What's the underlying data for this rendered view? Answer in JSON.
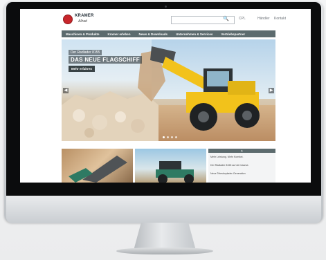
{
  "site": {
    "logo_text": "KRAMER",
    "logo_slogan": "Allrad",
    "header_links": [
      "CPL",
      "Händler",
      "Kontakt"
    ]
  },
  "nav": {
    "items": [
      "Maschinen & Produkte",
      "Kramer erleben",
      "News & Downloads",
      "Unternehmen & Services",
      "Vertriebspartner"
    ]
  },
  "hero": {
    "caption_small": "Der Radlader 8155",
    "caption_large": "DAS NEUE FLAGSCHIFF",
    "button_label": "Mehr erfahren",
    "arrow_left": "◀",
    "arrow_right": "▶",
    "slide_count": 4,
    "active_slide": 0
  },
  "news": {
    "header_glyph": "▲",
    "items": [
      "Mehr Leistung. Mehr Komfort.",
      "Der Radlader 8155 auf der bauma",
      "Neue Teleskoplader-Generation"
    ]
  },
  "colors": {
    "nav": "#5c6b6e",
    "accent_red": "#c8262b",
    "machine_yellow": "#f2c21b"
  }
}
